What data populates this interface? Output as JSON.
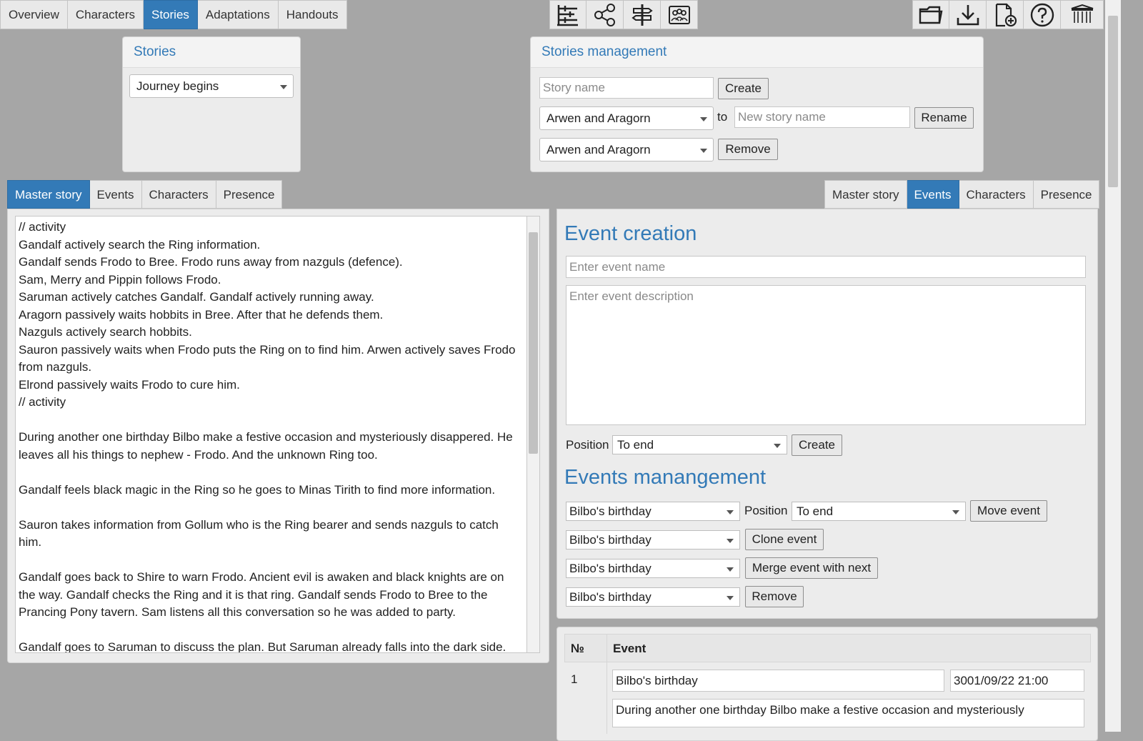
{
  "nav": {
    "tabs": [
      {
        "label": "Overview",
        "active": false
      },
      {
        "label": "Characters",
        "active": false
      },
      {
        "label": "Stories",
        "active": true
      },
      {
        "label": "Adaptations",
        "active": false
      },
      {
        "label": "Handouts",
        "active": false
      }
    ],
    "center_icons": [
      "timeline-icon",
      "share-network-icon",
      "signpost-icon",
      "group-photo-icon"
    ],
    "right_icons": [
      "open-folder-icon",
      "download-icon",
      "new-document-icon",
      "help-icon",
      "library-icon"
    ]
  },
  "stories_panel": {
    "title": "Stories",
    "selected_story": "Journey begins"
  },
  "management": {
    "title": "Stories management",
    "story_name_placeholder": "Story name",
    "create_label": "Create",
    "rename_select": "Arwen and Aragorn",
    "to_label": "to",
    "new_name_placeholder": "New story name",
    "rename_label": "Rename",
    "remove_select": "Arwen and Aragorn",
    "remove_label": "Remove"
  },
  "left_tabs": [
    {
      "label": "Master story",
      "active": true
    },
    {
      "label": "Events",
      "active": false
    },
    {
      "label": "Characters",
      "active": false
    },
    {
      "label": "Presence",
      "active": false
    }
  ],
  "right_tabs": [
    {
      "label": "Master story",
      "active": false
    },
    {
      "label": "Events",
      "active": true
    },
    {
      "label": "Characters",
      "active": false
    },
    {
      "label": "Presence",
      "active": false
    }
  ],
  "master_story_lines": [
    "// activity",
    "Gandalf actively search the Ring information.",
    "Gandalf sends Frodo to Bree. Frodo runs away from nazguls (defence).",
    "Sam, Merry and Pippin follows Frodo.",
    "Saruman actively catches Gandalf. Gandalf actively running away.",
    "Aragorn passively waits hobbits in Bree. After that he defends them.",
    "Nazguls actively search hobbits.",
    "Sauron passively waits when Frodo puts the Ring on to find him. Arwen actively saves Frodo",
    "from nazguls.",
    "Elrond passively waits Frodo to cure him.",
    "// activity",
    "",
    "During another one birthday Bilbo make a festive occasion and mysteriously disappered. He",
    "leaves all his things to nephew - Frodo. And the unknown Ring too.",
    "",
    "Gandalf feels black magic in the Ring so he goes to Minas Tirith to find more information.",
    "",
    "Sauron takes information from Gollum who is the Ring bearer and sends nazguls to catch",
    "him.",
    "",
    "Gandalf goes back to Shire to warn Frodo. Ancient evil is awaken and black knights are on",
    "the way. Gandalf checks the Ring and it is that ring. Gandalf sends Frodo to Bree to the",
    "Prancing Pony tavern. Sam listens all this conversation so he was added to party.",
    "",
    "Gandalf goes to Saruman to discuss the plan. But Saruman already falls into the dark side."
  ],
  "event_creation": {
    "title": "Event creation",
    "name_placeholder": "Enter event name",
    "description_placeholder": "Enter event description",
    "position_label": "Position",
    "position_value": "To end",
    "create_label": "Create"
  },
  "events_management": {
    "title": "Events manangement",
    "move_event_select": "Bilbo's birthday",
    "position_label": "Position",
    "position_value": "To end",
    "move_label": "Move event",
    "clone_event_select": "Bilbo's birthday",
    "clone_label": "Clone event",
    "merge_event_select": "Bilbo's birthday",
    "merge_label": "Merge event with next",
    "remove_event_select": "Bilbo's birthday",
    "remove_label": "Remove"
  },
  "events_table": {
    "col_num": "№",
    "col_event": "Event",
    "rows": [
      {
        "num": "1",
        "name": "Bilbo's birthday",
        "datetime": "3001/09/22 21:00",
        "description": "During another one birthday Bilbo make a festive occasion and mysteriously"
      }
    ]
  }
}
